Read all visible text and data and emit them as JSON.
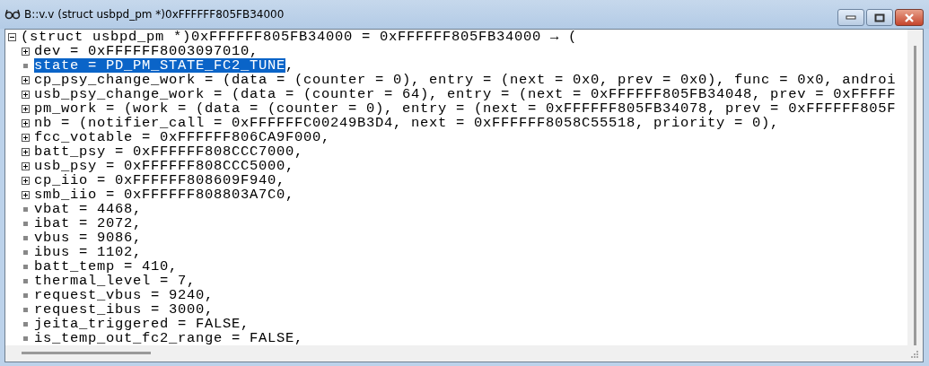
{
  "window": {
    "title": "B::v.v (struct usbpd_pm *)0xFFFFFF805FB34000"
  },
  "tree": {
    "text": "(struct usbpd_pm *)0xFFFFFF805FB34000 = 0xFFFFFF805FB34000 → (",
    "expanded": true,
    "selected": false,
    "children": [
      {
        "kind": "expandable",
        "expanded": false,
        "selected": false,
        "text": "dev = 0xFFFFFF8003097010,"
      },
      {
        "kind": "leaf",
        "selected": true,
        "text": "state = PD_PM_STATE_FC2_TUNE",
        "suffix": ","
      },
      {
        "kind": "expandable",
        "expanded": false,
        "selected": false,
        "text": "cp_psy_change_work = (data = (counter = 0), entry = (next = 0x0, prev = 0x0), func = 0x0, androi"
      },
      {
        "kind": "expandable",
        "expanded": false,
        "selected": false,
        "text": "usb_psy_change_work = (data = (counter = 64), entry = (next = 0xFFFFFF805FB34048, prev = 0xFFFFF"
      },
      {
        "kind": "expandable",
        "expanded": false,
        "selected": false,
        "text": "pm_work = (work = (data = (counter = 0), entry = (next = 0xFFFFFF805FB34078, prev = 0xFFFFFF805F"
      },
      {
        "kind": "expandable",
        "expanded": false,
        "selected": false,
        "text": "nb = (notifier_call = 0xFFFFFFC00249B3D4, next = 0xFFFFFF8058C55518, priority = 0),"
      },
      {
        "kind": "expandable",
        "expanded": false,
        "selected": false,
        "text": "fcc_votable = 0xFFFFFF806CA9F000,"
      },
      {
        "kind": "expandable",
        "expanded": false,
        "selected": false,
        "text": "batt_psy = 0xFFFFFF808CCC7000,"
      },
      {
        "kind": "expandable",
        "expanded": false,
        "selected": false,
        "text": "usb_psy = 0xFFFFFF808CCC5000,"
      },
      {
        "kind": "expandable",
        "expanded": false,
        "selected": false,
        "text": "cp_iio = 0xFFFFFF808609F940,"
      },
      {
        "kind": "expandable",
        "expanded": false,
        "selected": false,
        "text": "smb_iio = 0xFFFFFF808803A7C0,"
      },
      {
        "kind": "leaf",
        "selected": false,
        "text": "vbat = 4468,"
      },
      {
        "kind": "leaf",
        "selected": false,
        "text": "ibat = 2072,"
      },
      {
        "kind": "leaf",
        "selected": false,
        "text": "vbus = 9086,"
      },
      {
        "kind": "leaf",
        "selected": false,
        "text": "ibus = 1102,"
      },
      {
        "kind": "leaf",
        "selected": false,
        "text": "batt_temp = 410,"
      },
      {
        "kind": "leaf",
        "selected": false,
        "text": "thermal_level = 7,"
      },
      {
        "kind": "leaf",
        "selected": false,
        "text": "request_vbus = 9240,"
      },
      {
        "kind": "leaf",
        "selected": false,
        "text": "request_ibus = 3000,"
      },
      {
        "kind": "leaf",
        "selected": false,
        "text": "jeita_triggered = FALSE,"
      },
      {
        "kind": "leaf",
        "selected": false,
        "text": "is_temp_out_fc2_range = FALSE,"
      }
    ]
  }
}
